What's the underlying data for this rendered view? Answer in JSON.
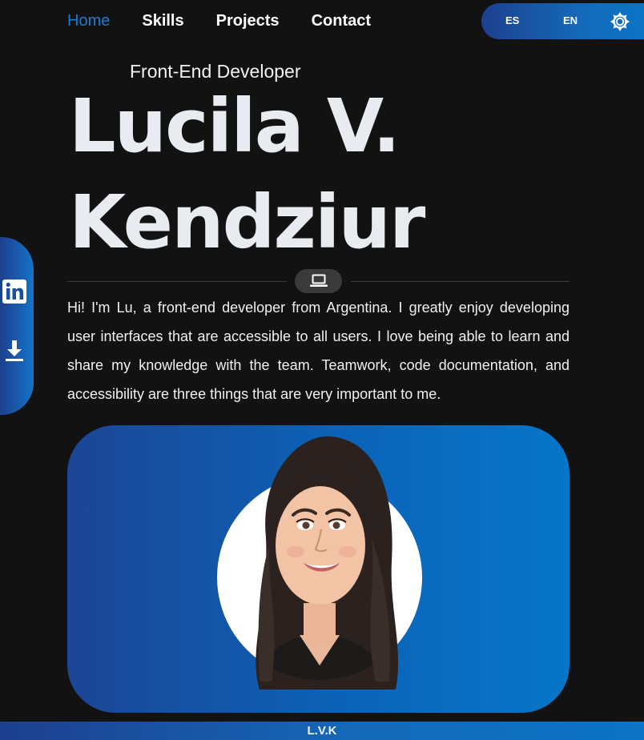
{
  "nav": {
    "items": [
      {
        "label": "Home",
        "active": true
      },
      {
        "label": "Skills",
        "active": false
      },
      {
        "label": "Projects",
        "active": false
      },
      {
        "label": "Contact",
        "active": false
      }
    ]
  },
  "lang": {
    "es_label": "ES",
    "en_label": "EN",
    "theme_icon": "sun-icon"
  },
  "hero": {
    "subtitle": "Front-End Developer",
    "name_line1": "Lucila V.",
    "name_line2": "Kendziur",
    "divider_icon": "laptop-icon",
    "bio": "Hi! I'm Lu, a front-end developer from Argentina. I greatly enjoy developing user interfaces that are accessible to all users. I love being able to learn and share my knowledge with the team. Teamwork, code documentation, and accessibility are three things that are very important to me."
  },
  "social": {
    "linkedin_icon": "linkedin-icon",
    "download_icon": "download-icon"
  },
  "avatar": {
    "icon": "avatar-illustration"
  },
  "footer": {
    "text": "L.V.K"
  },
  "colors": {
    "background": "#121212",
    "accent": "#1a7ad0",
    "gradient_start": "#1d3f8f",
    "gradient_end": "#0676c8"
  }
}
